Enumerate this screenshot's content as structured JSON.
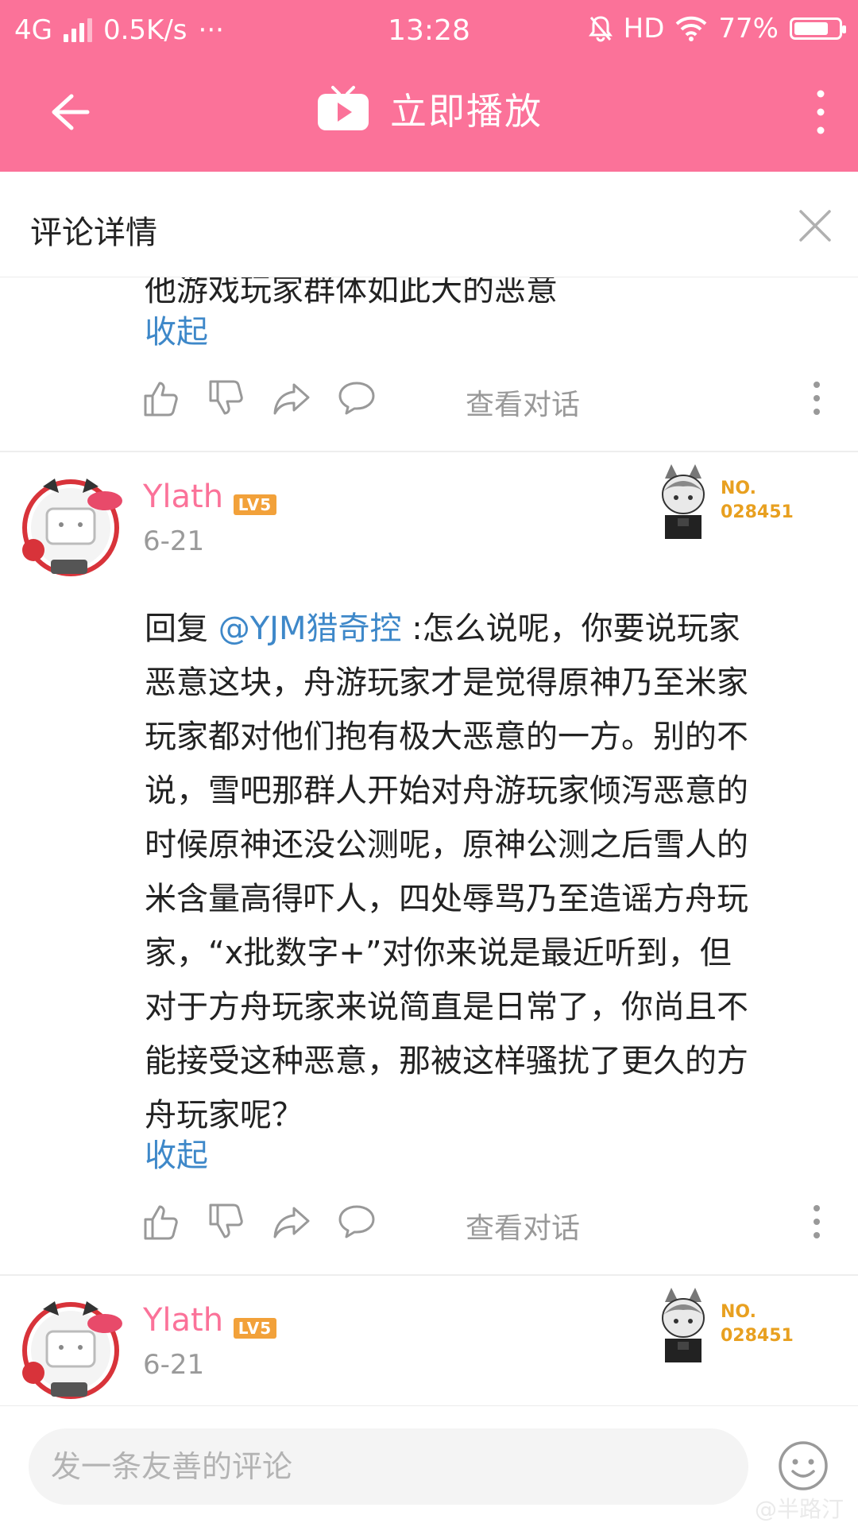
{
  "status_bar": {
    "network": "4G",
    "speed": "0.5K/s",
    "more": "···",
    "time": "13:28",
    "hd": "HD",
    "battery_text": "77%",
    "battery_level": 0.77
  },
  "header": {
    "title": "立即播放",
    "back_icon": "back-arrow-icon",
    "more_icon": "more-vertical-icon",
    "logo_icon": "tv-play-icon"
  },
  "panel": {
    "title": "评论详情",
    "close_icon": "close-icon"
  },
  "comments": [
    {
      "lines": [
        "他游戏玩家群体如此大的恶意"
      ],
      "collapse": "收起",
      "view_conversation": "查看对话"
    },
    {
      "user": "Ylath",
      "level": "LV5",
      "date": "6-21",
      "badge_no": "NO.",
      "badge_num": "028451",
      "reply_prefix": "回复 ",
      "mention": "@YJM猎奇控",
      "lines": [
        ":怎么说呢，你要说玩家",
        "恶意这块，舟游玩家才是觉得原神乃至米家",
        "玩家都对他们抱有极大恶意的一方。别的不",
        "说，雪吧那群人开始对舟游玩家倾泻恶意的",
        "时候原神还没公测呢，原神公测之后雪人的",
        "米含量高得吓人，四处辱骂乃至造谣方舟玩",
        "家，“x批数字+”对你来说是最近听到，但",
        "对于方舟玩家来说简直是日常了，你尚且不",
        "能接受这种恶意，那被这样骚扰了更久的方",
        "舟玩家呢？"
      ],
      "collapse": "收起",
      "view_conversation": "查看对话"
    },
    {
      "user": "Ylath",
      "level": "LV5",
      "date": "6-21",
      "badge_no": "NO.",
      "badge_num": "028451"
    }
  ],
  "input": {
    "placeholder": "发一条友善的评论",
    "emoji_icon": "emoji-icon"
  },
  "watermark": "@半路汀",
  "colors": {
    "brand_pink": "#fb7299",
    "link_blue": "#3e88c9",
    "level_orange": "#f2a13a",
    "badge_gold": "#e8a020"
  }
}
